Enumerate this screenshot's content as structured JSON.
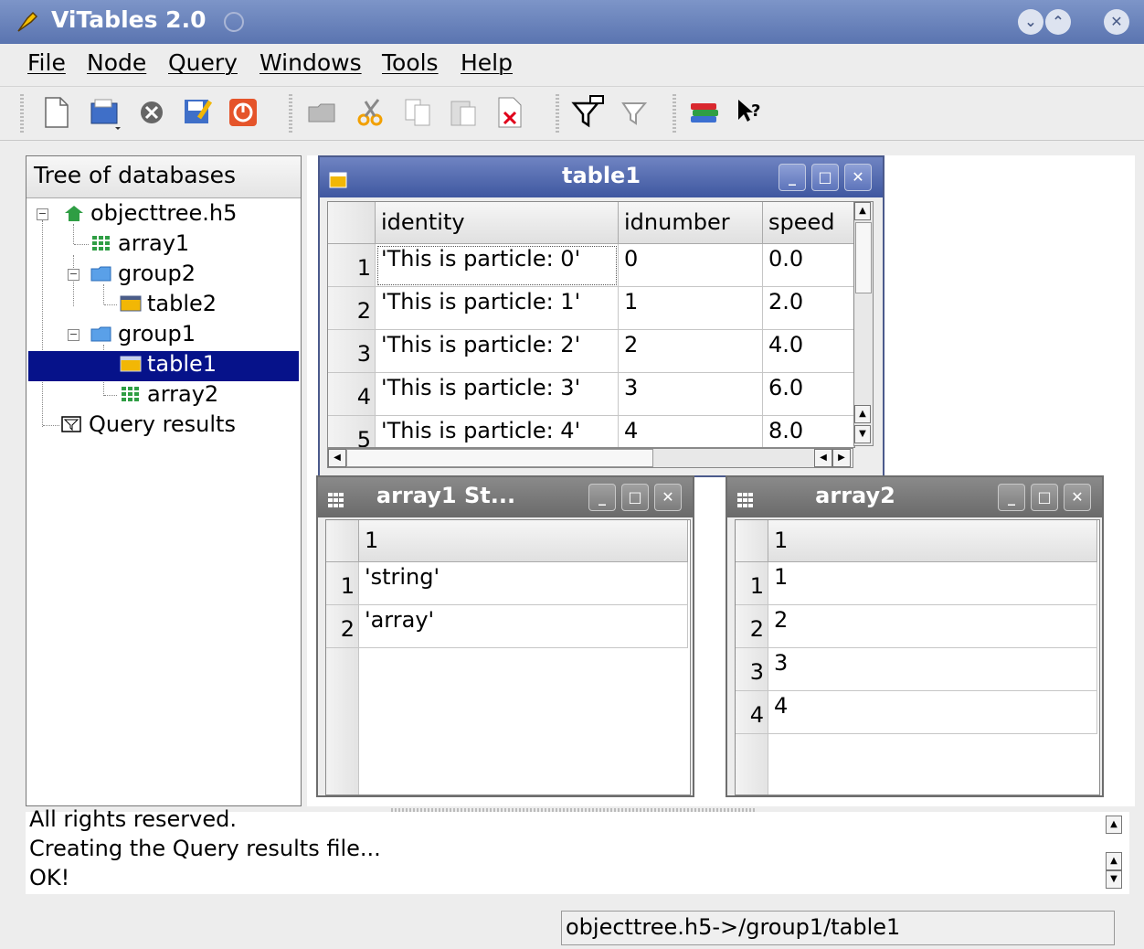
{
  "window": {
    "title": "ViTables 2.0"
  },
  "menu": [
    "File",
    "Node",
    "Query",
    "Windows",
    "Tools",
    "Help"
  ],
  "toolbar": {
    "icons": [
      "new-file-icon",
      "open-file-icon",
      "close-file-icon",
      "save-as-icon",
      "quit-icon",
      "new-group-icon",
      "cut-icon",
      "copy-icon",
      "paste-icon",
      "delete-icon",
      "query-icon",
      "delete-query-icon",
      "tables-help-icon",
      "whats-this-icon"
    ]
  },
  "tree": {
    "header": "Tree of databases",
    "items": [
      {
        "label": "objecttree.h5",
        "icon": "home-icon"
      },
      {
        "label": "array1",
        "icon": "array-icon"
      },
      {
        "label": "group2",
        "icon": "folder-icon"
      },
      {
        "label": "table2",
        "icon": "table-icon"
      },
      {
        "label": "group1",
        "icon": "folder-icon"
      },
      {
        "label": "table1",
        "icon": "table-icon",
        "selected": true
      },
      {
        "label": "array2",
        "icon": "array-icon"
      },
      {
        "label": "Query results",
        "icon": "query-results-icon"
      }
    ]
  },
  "table1": {
    "title": "table1",
    "columns": [
      "identity",
      "idnumber",
      "speed"
    ],
    "rows": [
      {
        "n": "1",
        "identity": "'This is particle:  0'",
        "idnumber": "0",
        "speed": "0.0"
      },
      {
        "n": "2",
        "identity": "'This is particle:  1'",
        "idnumber": "1",
        "speed": "2.0"
      },
      {
        "n": "3",
        "identity": "'This is particle:  2'",
        "idnumber": "2",
        "speed": "4.0"
      },
      {
        "n": "4",
        "identity": "'This is particle:  3'",
        "idnumber": "3",
        "speed": "6.0"
      },
      {
        "n": "5",
        "identity": "'This is particle:  4'",
        "idnumber": "4",
        "speed": "8.0"
      }
    ]
  },
  "array1": {
    "title": "array1 St...",
    "columns": [
      "1"
    ],
    "rows": [
      {
        "n": "1",
        "v": "'string'"
      },
      {
        "n": "2",
        "v": "'array'"
      }
    ]
  },
  "array2": {
    "title": "array2",
    "columns": [
      "1"
    ],
    "rows": [
      {
        "n": "1",
        "v": "1"
      },
      {
        "n": "2",
        "v": "2"
      },
      {
        "n": "3",
        "v": "3"
      },
      {
        "n": "4",
        "v": "4"
      }
    ]
  },
  "log": {
    "lines": [
      "All rights reserved.",
      "Creating the Query results file...",
      "OK!"
    ]
  },
  "status": "objecttree.h5->/group1/table1"
}
